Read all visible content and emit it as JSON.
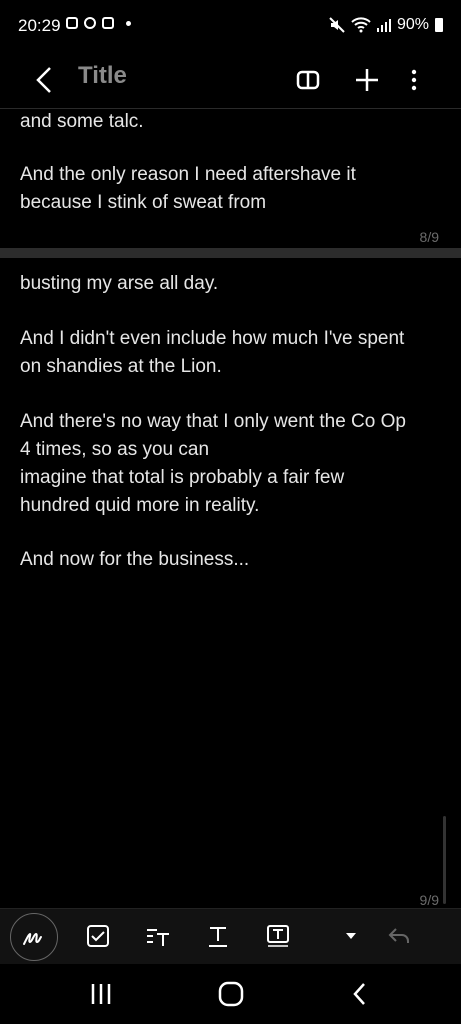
{
  "status_bar": {
    "time": "20:29",
    "battery": "90%"
  },
  "app_bar": {
    "title": "Title"
  },
  "pages": [
    {
      "paragraphs": [
        "and some talc.",
        "And the only reason I need aftershave it\nbecause I stink of sweat from"
      ],
      "page_number": "8/9"
    },
    {
      "paragraphs": [
        "busting my arse all day.",
        "And I didn't even include how much I've spent\non shandies at the Lion.",
        "And there's no way that I only went the Co Op\n4 times, so as you can\nimagine that total is probably a fair few\nhundred quid more in reality.",
        "And now for the business..."
      ],
      "page_number": "9/9"
    }
  ],
  "toolbar": {
    "icons": [
      "pen-icon",
      "checkbox-icon",
      "text-style-icon",
      "text-underline-icon",
      "text-box-icon",
      "dropdown-icon",
      "undo-icon"
    ]
  },
  "navigation": {
    "icons": [
      "recent-apps-icon",
      "home-icon",
      "back-icon"
    ]
  },
  "colors": {
    "background": "#000000",
    "text": "#e6e6e6",
    "page_divider": "#2c2c2c",
    "toolbar": "#121212"
  }
}
